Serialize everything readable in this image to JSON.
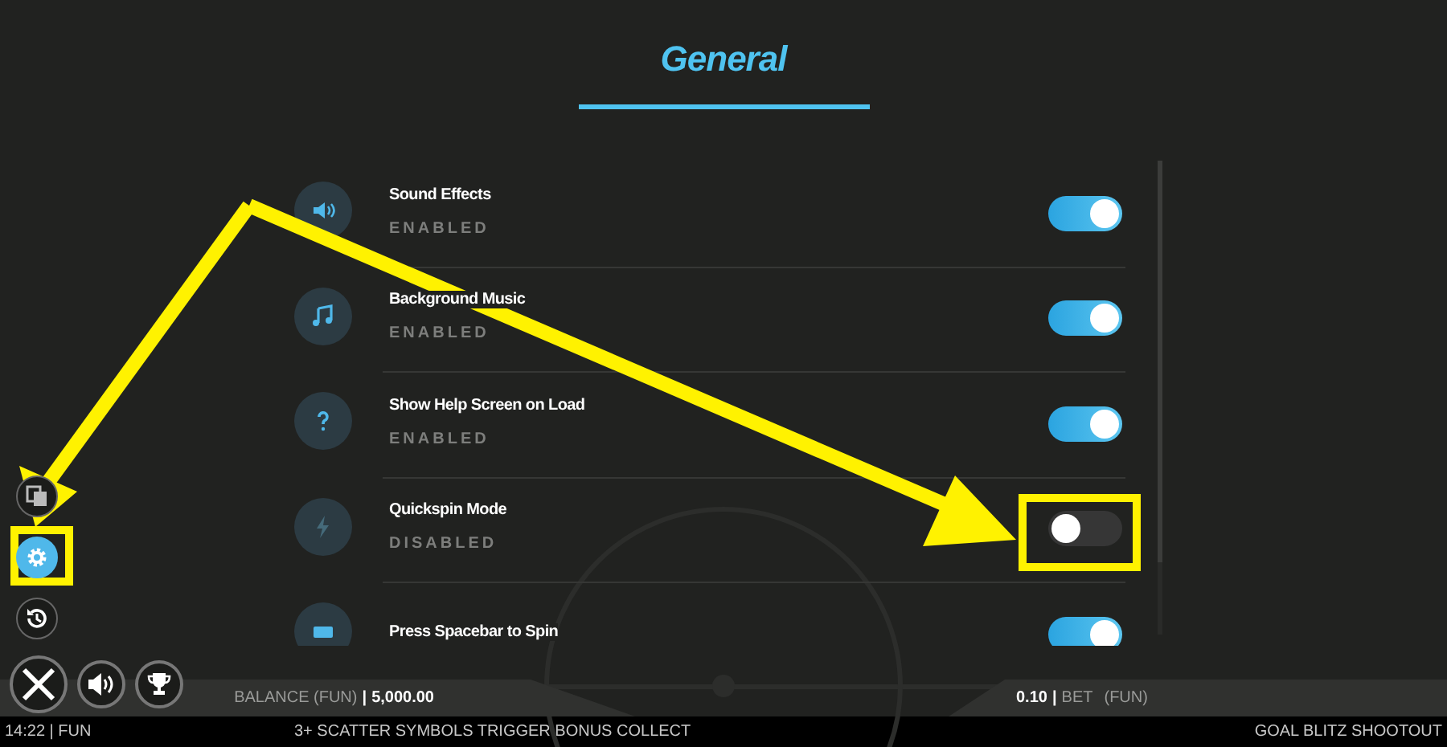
{
  "header": {
    "title": "General"
  },
  "settings": [
    {
      "label": "Sound Effects",
      "status": "ENABLED",
      "on": true
    },
    {
      "label": "Background Music",
      "status": "ENABLED",
      "on": true
    },
    {
      "label": "Show Help Screen on Load",
      "status": "ENABLED",
      "on": true
    },
    {
      "label": "Quickspin Mode",
      "status": "DISABLED",
      "on": false
    },
    {
      "label": "Press Spacebar to Spin",
      "on": true
    }
  ],
  "side_buttons": [
    {
      "selected": false
    },
    {
      "selected": true
    },
    {
      "selected": false
    }
  ],
  "bottom_bar": {
    "balance_label": "BALANCE (FUN)",
    "balance_separator": "|",
    "balance": "5,000.00",
    "bet": "0.10",
    "bet_separator": "|",
    "bet_label": "BET",
    "bet_currency": "(FUN)"
  },
  "footer": {
    "clock": "14:22 | FUN",
    "message": "3+ SCATTER SYMBOLS TRIGGER BONUS COLLECT",
    "game_title": "GOAL BLITZ SHOOTOUT"
  }
}
